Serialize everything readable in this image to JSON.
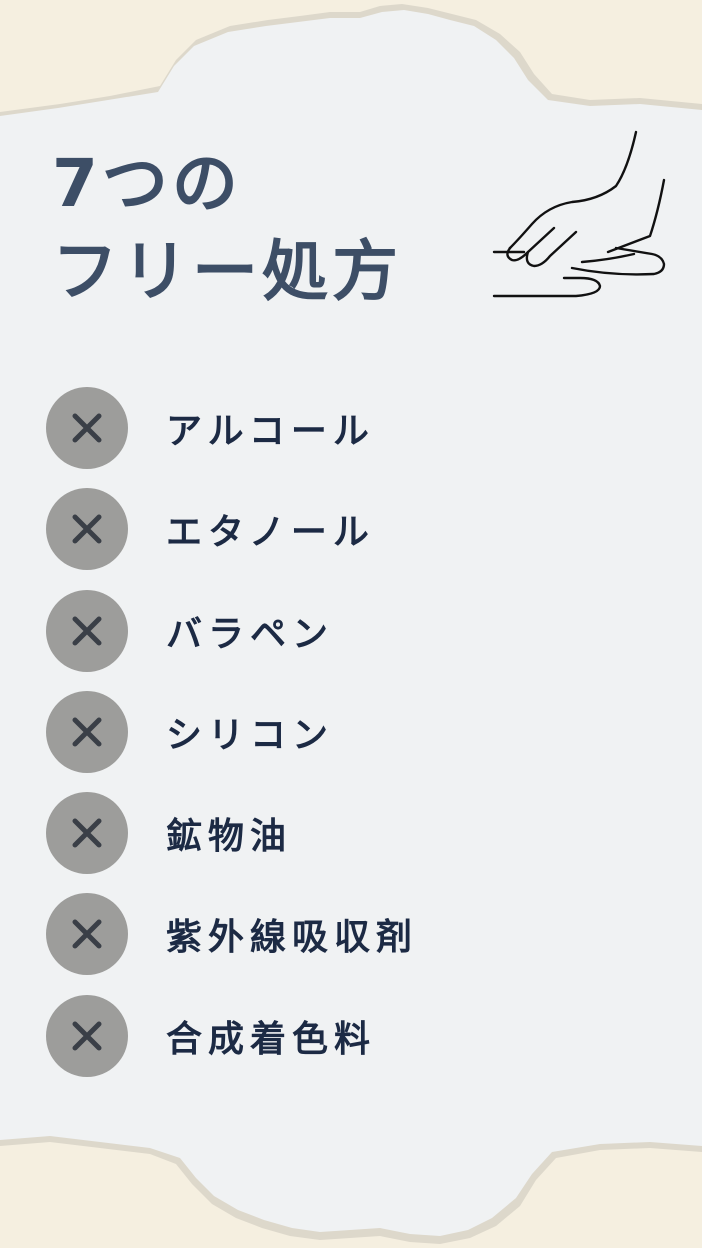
{
  "title": {
    "line1": "7つの",
    "line2": "フリー処方"
  },
  "illustration": {
    "icon": "hands-icon"
  },
  "colors": {
    "background_outer": "#f5efe0",
    "card": "#f0f2f3",
    "title": "#3d4e66",
    "badge": "#9d9d9b",
    "badge_mark": "#3a3f47",
    "label": "#1c2a44"
  },
  "items": [
    {
      "label": "アルコール",
      "icon": "x-icon"
    },
    {
      "label": "エタノール",
      "icon": "x-icon"
    },
    {
      "label": "バラペン",
      "icon": "x-icon"
    },
    {
      "label": "シリコン",
      "icon": "x-icon"
    },
    {
      "label": "鉱物油",
      "icon": "x-icon"
    },
    {
      "label": "紫外線吸収剤",
      "icon": "x-icon"
    },
    {
      "label": "合成着色料",
      "icon": "x-icon"
    }
  ]
}
